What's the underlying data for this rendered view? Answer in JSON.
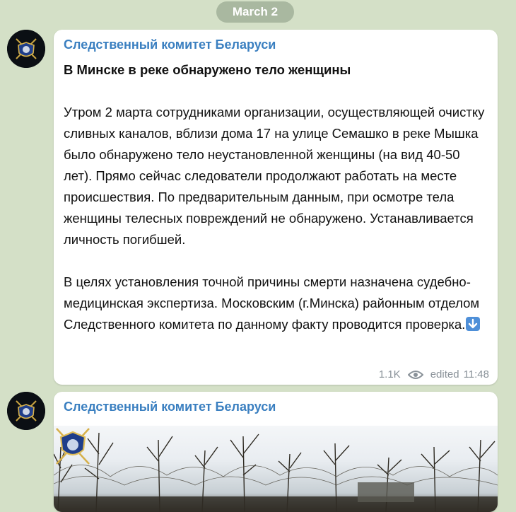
{
  "date_divider": "March 2",
  "messages": [
    {
      "sender": "Следственный комитет Беларуси",
      "title": "В Минске в реке обнаружено тело женщины",
      "paragraph_1": "Утром 2 марта сотрудниками организации, осуществляющей очистку сливных каналов, вблизи дома 17 на улице Семашко в реке Мышка было обнаружено тело неустановленной женщины (на вид 40-50 лет). Прямо сейчас следователи продолжают работать на месте происшествия. По предварительным данным, при осмотре тела женщины телесных повреждений не обнаружено. Устанавливается личность погибшей.",
      "paragraph_2": "В целях установления точной причины смерти назначена судебно-медицинская экспертиза. Московским (г.Минска) районным отделом Следственного комитета по данному факту проводится проверка.",
      "trailing_icon": "down-arrow-emoji",
      "views": "1.1K",
      "edited_label": "edited",
      "time": "11:48"
    },
    {
      "sender": "Следственный комитет Беларуси",
      "media": "photo"
    }
  ],
  "colors": {
    "chat_background": "#d4e0c7",
    "sender_name": "#3a7fc0",
    "date_pill": "#a9b8a0",
    "meta_text": "#8a9299"
  }
}
